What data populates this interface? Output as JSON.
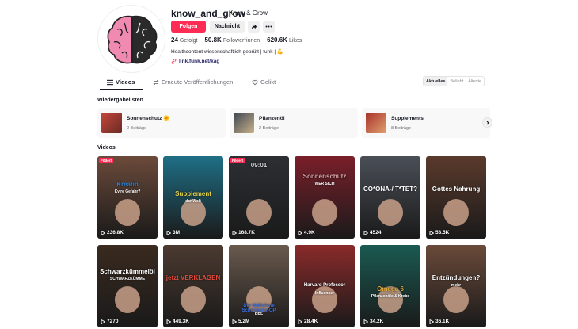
{
  "profile": {
    "username": "know_and_grow",
    "nickname": "Know & Grow",
    "follow_label": "Folgen",
    "message_label": "Nachricht",
    "stats": [
      {
        "value": "24",
        "label": "Gefolgt"
      },
      {
        "value": "50.8K",
        "label": "Follower*innen"
      },
      {
        "value": "620.6K",
        "label": "Likes"
      }
    ],
    "bio": "Healthcontent wissenschaftlich geprüft | funk | 💪",
    "link": "link.funk.net/kag"
  },
  "tabs": [
    {
      "label": "Videos",
      "icon": "grid-icon"
    },
    {
      "label": "Erneute Veröffentlichungen",
      "icon": "repost-icon"
    },
    {
      "label": "Gelikt",
      "icon": "heart-icon"
    }
  ],
  "sort": [
    "Aktuelles",
    "Beliebt",
    "Älteste"
  ],
  "playlists_title": "Wiedergabelisten",
  "playlists": [
    {
      "title": "Sonnenschutz 🌞",
      "count": "2 Beiträge",
      "color": "#c4473b"
    },
    {
      "title": "Pflanzenöl",
      "count": "2 Beiträge",
      "color": "#3d4452"
    },
    {
      "title": "Supplements",
      "count": "8 Beiträge",
      "color": "#a8322b"
    }
  ],
  "videos_title": "Videos",
  "videos": [
    {
      "views": "236.8K",
      "badge": "Födert",
      "caption": "Kreatin",
      "caption2": "Ky're Gefahr?",
      "bg": "#6b4a3a",
      "accent": "#2a7fd6"
    },
    {
      "views": "3M",
      "badge": "",
      "caption": "Supplement",
      "caption2": "der Welt",
      "bg": "#1f6f86",
      "accent": "#e8d64a"
    },
    {
      "views": "168.7K",
      "badge": "Födert",
      "caption": "09:01",
      "caption2": "",
      "bg": "#2c2f33",
      "accent": "#cfd2d6"
    },
    {
      "views": "4.9K",
      "badge": "",
      "caption": "Sonnenschutz",
      "caption2": "WER SICH",
      "bg": "#7a1f2a",
      "accent": "#d8a1a8"
    },
    {
      "views": "4524",
      "badge": "",
      "caption": "CO*ONA-/ T*TET?",
      "caption2": "",
      "bg": "#4a4f57",
      "accent": "#ffffff"
    },
    {
      "views": "53.5K",
      "badge": "",
      "caption": "Gottes Nahrung",
      "caption2": "",
      "bg": "#5a3a2c",
      "accent": "#ffffff"
    },
    {
      "views": "7270",
      "badge": "",
      "caption": "Schwarzkümmelöl",
      "caption2": "SCHWARZKÜMME",
      "bg": "#3a2a1f",
      "accent": "#ffffff"
    },
    {
      "views": "449.3K",
      "badge": "",
      "caption": "jetzt VERKLAGEN",
      "caption2": "",
      "bg": "#4b3a30",
      "accent": "#e14b3b"
    },
    {
      "views": "5.2M",
      "badge": "",
      "caption": "Die tödlichste Schönheits-OP",
      "caption2": "BBL",
      "bg": "#6a5a4e",
      "accent": "#3a6fe0"
    },
    {
      "views": "28.4K",
      "badge": "",
      "caption": "Harvard Professor",
      "caption2": "Influencer",
      "bg": "#8a2a2a",
      "accent": "#ffffff"
    },
    {
      "views": "34.2K",
      "badge": "",
      "caption": "Omega 6",
      "caption2": "Pflanzenöle & Krebs",
      "bg": "#1a5a52",
      "accent": "#e0a83a"
    },
    {
      "views": "36.1K",
      "badge": "",
      "caption": "Entzündungen?",
      "caption2": "mehr",
      "bg": "#6a4a3a",
      "accent": "#ffffff"
    }
  ]
}
